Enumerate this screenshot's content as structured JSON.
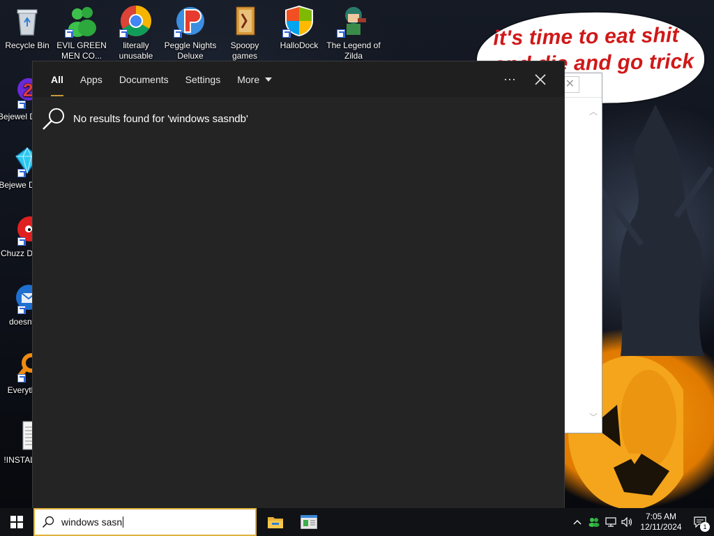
{
  "desktop": {
    "icons_top": [
      {
        "label": "Recycle Bin",
        "icon": "recycle-bin-icon"
      },
      {
        "label": "EVIL GREEN MEN CO...",
        "icon": "people-icon"
      },
      {
        "label": "literally unusable",
        "icon": "chrome-icon"
      },
      {
        "label": "Peggle Nights Deluxe",
        "icon": "peggle-icon"
      },
      {
        "label": "Spoopy games",
        "icon": "folder-icon"
      },
      {
        "label": "HalloDock",
        "icon": "shield-icon"
      },
      {
        "label": "The Legend of Zilda",
        "icon": "character-icon"
      }
    ],
    "icons_left": [
      {
        "label": "Bejewel Delux",
        "icon": "bejeweled-2-icon"
      },
      {
        "label": "Bejewe Delux",
        "icon": "diamond-icon"
      },
      {
        "label": "Chuzz Delux",
        "icon": "chuzzle-icon"
      },
      {
        "label": "doesnt",
        "icon": "thunderbird-icon"
      },
      {
        "label": "Everyth",
        "icon": "everything-search-icon"
      },
      {
        "label": "!INSTALL",
        "icon": "text-file-icon"
      }
    ],
    "wallpaper_text": "it's time to eat shit and die and go trick and vote!"
  },
  "search_panel": {
    "tabs": [
      {
        "label": "All",
        "active": true
      },
      {
        "label": "Apps",
        "active": false
      },
      {
        "label": "Documents",
        "active": false
      },
      {
        "label": "Settings",
        "active": false
      },
      {
        "label": "More",
        "active": false
      }
    ],
    "more_options_label": "···",
    "close_label": "✕",
    "no_results_message": "No results found for 'windows sasndb'"
  },
  "taskbar": {
    "search_query": "windows sasn",
    "pinned_apps": [
      "file-explorer-icon",
      "app-window-icon"
    ],
    "clock_time": "7:05 AM",
    "clock_date": "12/11/2024",
    "notification_count": "1"
  },
  "colors": {
    "panel_bg": "#242424",
    "tab_underline": "#c69a3b",
    "search_border": "#e0b23c",
    "wallpaper_text": "#d01818"
  }
}
